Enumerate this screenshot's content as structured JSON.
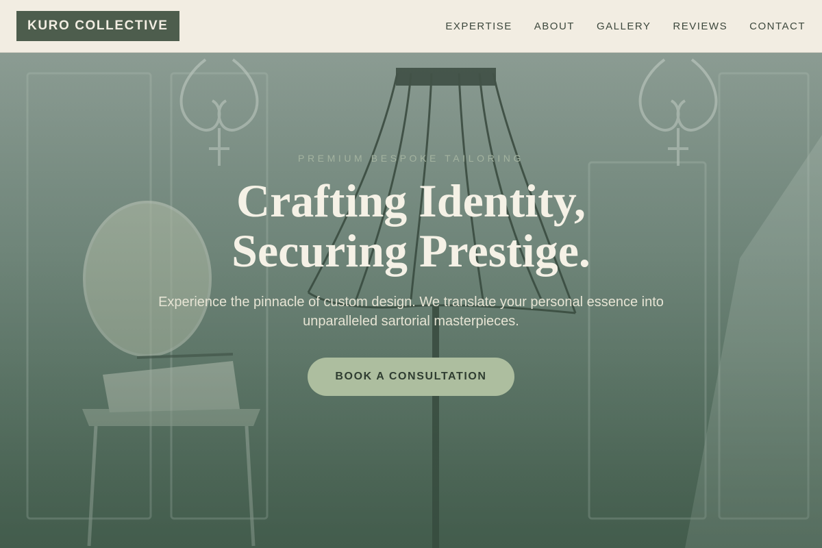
{
  "brand": {
    "name": "KURO COLLECTIVE"
  },
  "nav": {
    "items": [
      {
        "label": "EXPERTISE"
      },
      {
        "label": "ABOUT"
      },
      {
        "label": "GALLERY"
      },
      {
        "label": "REVIEWS"
      },
      {
        "label": "CONTACT"
      }
    ]
  },
  "hero": {
    "eyebrow": "PREMIUM BESPOKE TAILORING",
    "headline_line1": "Crafting Identity,",
    "headline_line2": "Securing Prestige.",
    "subtext": "Experience the pinnacle of custom design. We translate your personal essence into unparalleled sartorial masterpieces.",
    "cta_label": "BOOK A CONSULTATION"
  },
  "colors": {
    "header_bg": "#f2ede2",
    "logo_bg": "#4d5d4d",
    "cta_bg": "#adbe9f",
    "hero_bottom": "#4a6151",
    "headline_text": "#f5f1e6"
  }
}
